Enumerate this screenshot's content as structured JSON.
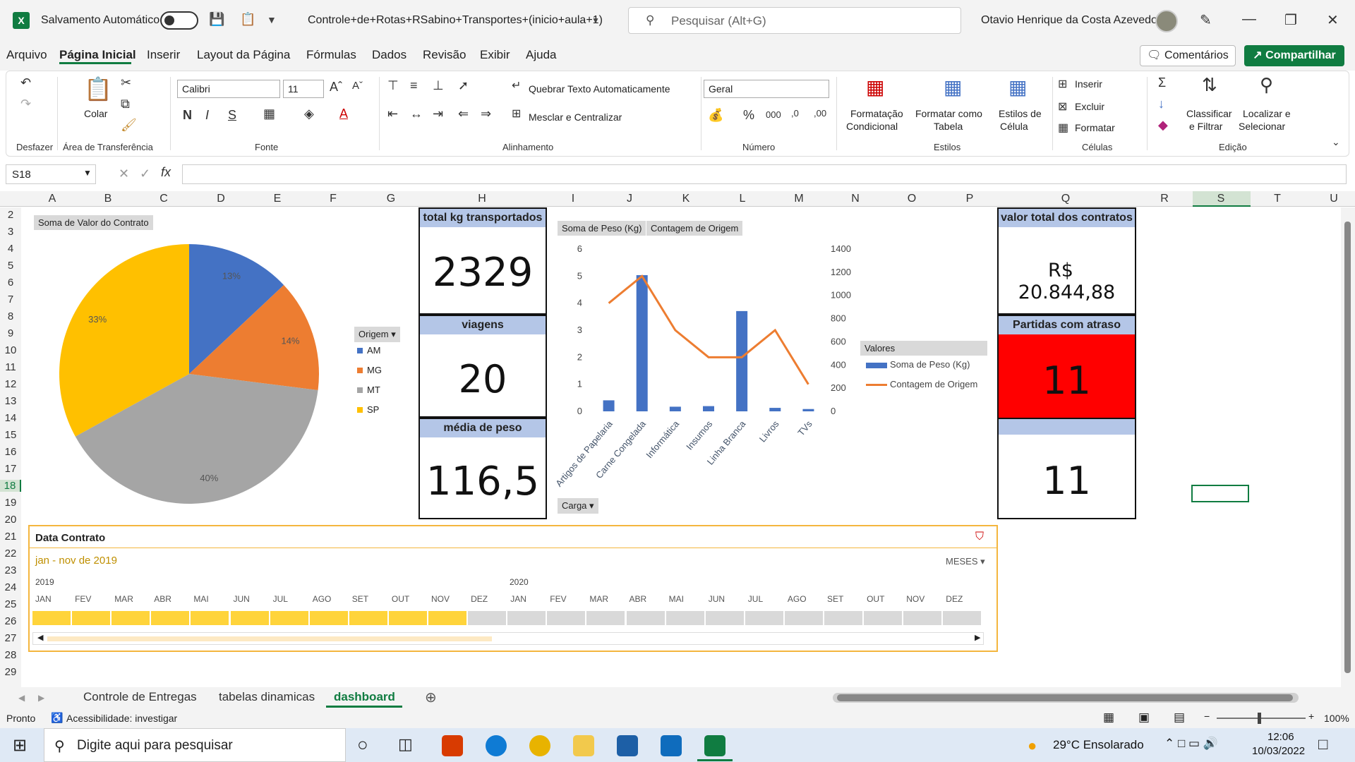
{
  "titlebar": {
    "autosave_label": "Salvamento Automático",
    "doc_title": "Controle+de+Rotas+RSabino+Transportes+(inicio+aula+1)",
    "search_placeholder": "Pesquisar (Alt+G)",
    "user_name": "Otavio Henrique da Costa Azevedo"
  },
  "menu": {
    "items": [
      "Arquivo",
      "Página Inicial",
      "Inserir",
      "Layout da Página",
      "Fórmulas",
      "Dados",
      "Revisão",
      "Exibir",
      "Ajuda"
    ],
    "active": "Página Inicial",
    "comments": "Comentários",
    "share": "Compartilhar"
  },
  "ribbon": {
    "groups": {
      "undo": "Desfazer",
      "clipboard": "Área de Transferência",
      "font": "Fonte",
      "alignment": "Alinhamento",
      "number": "Número",
      "styles": "Estilos",
      "cells": "Células",
      "editing": "Edição"
    },
    "paste": "Colar",
    "font_name": "Calibri",
    "font_size": "11",
    "wrap_text": "Quebrar Texto Automaticamente",
    "merge_center": "Mesclar e Centralizar",
    "number_format": "Geral",
    "cond_format": [
      "Formatação",
      "Condicional"
    ],
    "format_table": [
      "Formatar como",
      "Tabela"
    ],
    "cell_styles": [
      "Estilos de",
      "Célula"
    ],
    "insert": "Inserir",
    "delete": "Excluir",
    "format": "Formatar",
    "sort_filter": [
      "Classificar",
      "e Filtrar"
    ],
    "find_select": [
      "Localizar e",
      "Selecionar"
    ]
  },
  "formula_bar": {
    "name_box": "S18",
    "fx": "fx",
    "value": ""
  },
  "columns": [
    "A",
    "B",
    "C",
    "D",
    "E",
    "F",
    "G",
    "H",
    "I",
    "J",
    "K",
    "L",
    "M",
    "N",
    "O",
    "P",
    "Q",
    "R",
    "S",
    "T",
    "U"
  ],
  "rows": [
    "2",
    "3",
    "4",
    "5",
    "6",
    "7",
    "8",
    "9",
    "10",
    "11",
    "12",
    "13",
    "14",
    "15",
    "16",
    "17",
    "18",
    "19",
    "20",
    "21",
    "22",
    "23",
    "24",
    "25",
    "26",
    "27",
    "28",
    "29"
  ],
  "pie": {
    "field_button": "Soma de Valor do Contrato",
    "legend_title": "Origem",
    "slices": [
      {
        "label": "AM",
        "pct": 13,
        "text": "13%",
        "color": "#4472c4"
      },
      {
        "label": "MG",
        "pct": 14,
        "text": "14%",
        "color": "#ed7d31"
      },
      {
        "label": "MT",
        "pct": 40,
        "text": "40%",
        "color": "#a5a5a5"
      },
      {
        "label": "SP",
        "pct": 33,
        "text": "33%",
        "color": "#ffc000"
      }
    ]
  },
  "cards": {
    "kg_title": "total kg transportados",
    "kg_value": "2329",
    "trips_title": "viagens",
    "trips_value": "20",
    "avg_title": "média de peso",
    "avg_value": "116,5",
    "contracts_title": "valor total dos contratos",
    "contracts_currency": "R$",
    "contracts_value": "20.844,88",
    "late_title": "Partidas com atraso",
    "late_value": "11",
    "extra_value": "11"
  },
  "chart_data": {
    "type": "bar",
    "field_buttons": [
      "Soma de Peso (Kg)",
      "Contagem de Origem"
    ],
    "axis_button": "Carga",
    "legend_title": "Valores",
    "categories": [
      "Artigos de Papelaria",
      "Carne Congelada",
      "Informática",
      "Insumos",
      "Linha Branca",
      "Livros",
      "TVs"
    ],
    "series": [
      {
        "name": "Soma de Peso (Kg)",
        "type": "bar",
        "axis": "right",
        "values": [
          95,
          1175,
          40,
          45,
          865,
          30,
          20
        ],
        "color": "#4472c4"
      },
      {
        "name": "Contagem de Origem",
        "type": "line",
        "axis": "left",
        "values": [
          4,
          5,
          3,
          2,
          2,
          3,
          1
        ],
        "color": "#ed7d31"
      }
    ],
    "left_ticks": [
      "0",
      "1",
      "2",
      "3",
      "4",
      "5",
      "6"
    ],
    "right_ticks": [
      "0",
      "200",
      "400",
      "600",
      "800",
      "1000",
      "1200",
      "1400"
    ],
    "left_lim": [
      0,
      6
    ],
    "right_lim": [
      0,
      1400
    ]
  },
  "timeline": {
    "title": "Data Contrato",
    "range": "jan - nov de 2019",
    "level": "MESES",
    "years": [
      "2019",
      "2020"
    ],
    "months": [
      "JAN",
      "FEV",
      "MAR",
      "ABR",
      "MAI",
      "JUN",
      "JUL",
      "AGO",
      "SET",
      "OUT",
      "NOV",
      "DEZ",
      "JAN",
      "FEV",
      "MAR",
      "ABR",
      "MAI",
      "JUN",
      "JUL",
      "AGO",
      "SET",
      "OUT",
      "NOV",
      "DEZ"
    ],
    "selected_count": 11
  },
  "sheets": {
    "tabs": [
      "Controle de Entregas",
      "tabelas dinamicas",
      "dashboard"
    ],
    "active": "dashboard"
  },
  "status": {
    "ready": "Pronto",
    "accessibility": "Acessibilidade: investigar",
    "zoom": "100%"
  },
  "taskbar": {
    "search_placeholder": "Digite aqui para pesquisar",
    "weather": "29°C  Ensolarado",
    "time": "12:06",
    "date": "10/03/2022"
  }
}
